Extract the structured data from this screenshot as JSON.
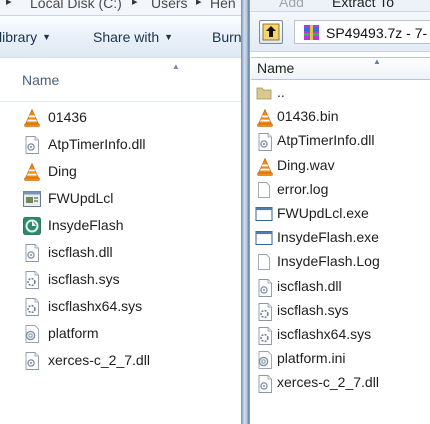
{
  "explorer": {
    "breadcrumb": [
      "Local Disk (C:)",
      "Users",
      "Hen"
    ],
    "toolbar": [
      {
        "label": "library",
        "has_dropdown": true
      },
      {
        "label": "Share with",
        "has_dropdown": true
      },
      {
        "label": "Burn",
        "has_dropdown": false
      }
    ],
    "column_header": "Name",
    "files": [
      {
        "name": "01436",
        "icon": "vlc-icon"
      },
      {
        "name": "AtpTimerInfo.dll",
        "icon": "dll-icon"
      },
      {
        "name": "Ding",
        "icon": "vlc-icon"
      },
      {
        "name": "FWUpdLcl",
        "icon": "app-icon"
      },
      {
        "name": "InsydeFlash",
        "icon": "insyde-icon"
      },
      {
        "name": "iscflash.dll",
        "icon": "dll-icon"
      },
      {
        "name": "iscflash.sys",
        "icon": "sys-icon"
      },
      {
        "name": "iscflashx64.sys",
        "icon": "sys-icon"
      },
      {
        "name": "platform",
        "icon": "ini-icon"
      },
      {
        "name": "xerces-c_2_7.dll",
        "icon": "dll-icon"
      }
    ]
  },
  "sevenzip": {
    "menu": [
      "Add",
      "Extract To"
    ],
    "path": "SP49493.7z - 7-",
    "column_header": "Name",
    "files": [
      {
        "name": "..",
        "icon": "folder-up-icon"
      },
      {
        "name": "01436.bin",
        "icon": "vlc-icon"
      },
      {
        "name": "AtpTimerInfo.dll",
        "icon": "dll-icon"
      },
      {
        "name": "Ding.wav",
        "icon": "vlc-icon"
      },
      {
        "name": "error.log",
        "icon": "text-icon"
      },
      {
        "name": "FWUpdLcl.exe",
        "icon": "exe-icon"
      },
      {
        "name": "InsydeFlash.exe",
        "icon": "exe-icon"
      },
      {
        "name": "InsydeFlash.Log",
        "icon": "text-icon"
      },
      {
        "name": "iscflash.dll",
        "icon": "dll-icon"
      },
      {
        "name": "iscflash.sys",
        "icon": "sys-icon"
      },
      {
        "name": "iscflashx64.sys",
        "icon": "sys-icon"
      },
      {
        "name": "platform.ini",
        "icon": "ini-icon"
      },
      {
        "name": "xerces-c_2_7.dll",
        "icon": "dll-icon"
      }
    ]
  }
}
